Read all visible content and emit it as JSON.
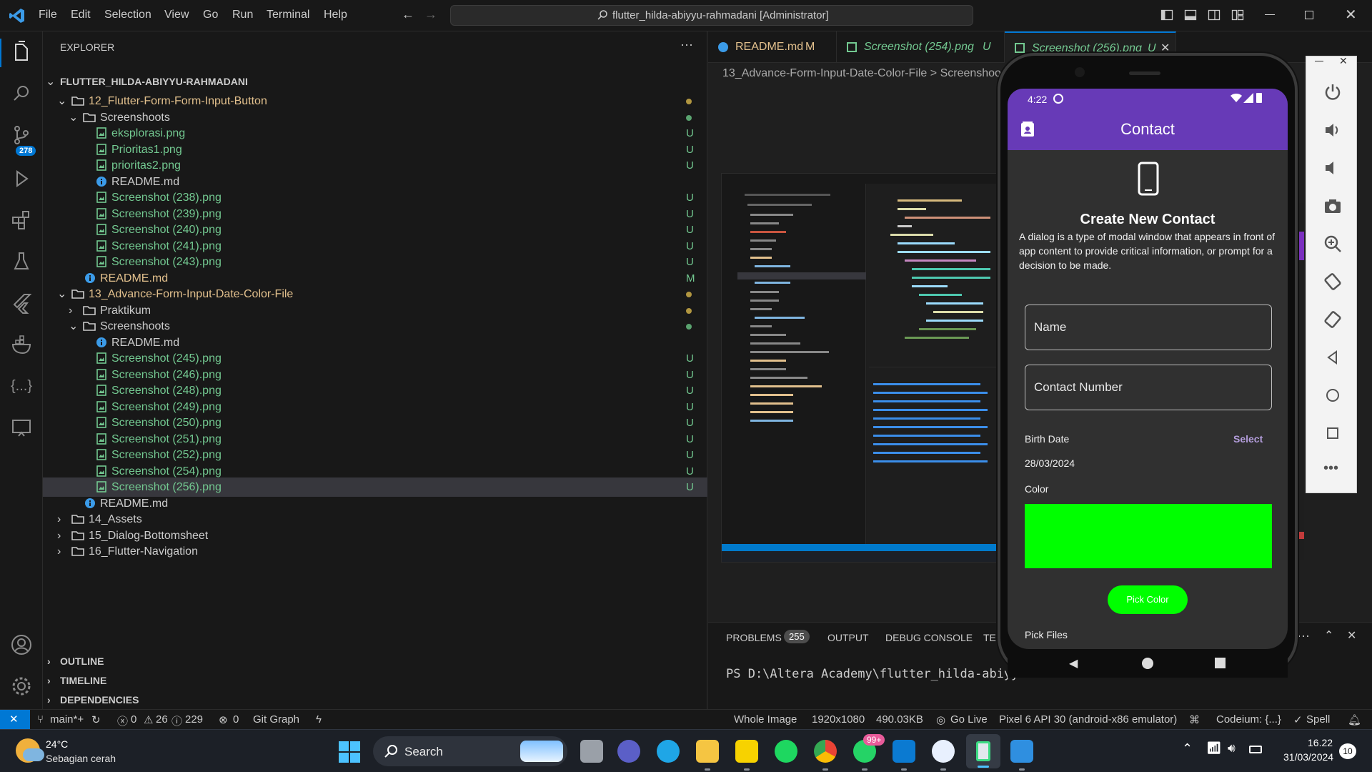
{
  "titlebar": {
    "menus": [
      "File",
      "Edit",
      "Selection",
      "View",
      "Go",
      "Run",
      "Terminal",
      "Help"
    ],
    "command_center": "flutter_hilda-abiyyu-rahmadani [Administrator]"
  },
  "activitybar": {
    "scm_badge": "278"
  },
  "explorer": {
    "title": "EXPLORER",
    "root": "FLUTTER_HILDA-ABIYYU-RAHMADANI",
    "rows": [
      {
        "label": "12_Flutter-Form-Form-Input-Button",
        "status": ""
      },
      {
        "label": "Screenshoots",
        "status": ""
      },
      {
        "label": "eksplorasi.png",
        "status": "U"
      },
      {
        "label": "Prioritas1.png",
        "status": "U"
      },
      {
        "label": "prioritas2.png",
        "status": "U"
      },
      {
        "label": "README.md",
        "status": ""
      },
      {
        "label": "Screenshot (238).png",
        "status": "U"
      },
      {
        "label": "Screenshot (239).png",
        "status": "U"
      },
      {
        "label": "Screenshot (240).png",
        "status": "U"
      },
      {
        "label": "Screenshot (241).png",
        "status": "U"
      },
      {
        "label": "Screenshot (243).png",
        "status": "U"
      },
      {
        "label": "README.md",
        "status": "M"
      },
      {
        "label": "13_Advance-Form-Input-Date-Color-File",
        "status": ""
      },
      {
        "label": "Praktikum",
        "status": ""
      },
      {
        "label": "Screenshoots",
        "status": ""
      },
      {
        "label": "README.md",
        "status": ""
      },
      {
        "label": "Screenshot (245).png",
        "status": "U"
      },
      {
        "label": "Screenshot (246).png",
        "status": "U"
      },
      {
        "label": "Screenshot (248).png",
        "status": "U"
      },
      {
        "label": "Screenshot (249).png",
        "status": "U"
      },
      {
        "label": "Screenshot (250).png",
        "status": "U"
      },
      {
        "label": "Screenshot (251).png",
        "status": "U"
      },
      {
        "label": "Screenshot (252).png",
        "status": "U"
      },
      {
        "label": "Screenshot (254).png",
        "status": "U"
      },
      {
        "label": "Screenshot (256).png",
        "status": "U"
      },
      {
        "label": "README.md",
        "status": ""
      },
      {
        "label": "14_Assets",
        "status": ""
      },
      {
        "label": "15_Dialog-Bottomsheet",
        "status": ""
      },
      {
        "label": "16_Flutter-Navigation",
        "status": ""
      }
    ],
    "sections": [
      "OUTLINE",
      "TIMELINE",
      "DEPENDENCIES"
    ]
  },
  "editor": {
    "tabs": [
      {
        "label": "README.md",
        "status": "M"
      },
      {
        "label": "Screenshot (254).png",
        "status": "U"
      },
      {
        "label": "Screenshot (256).png",
        "status": "U"
      }
    ],
    "breadcrumb": "13_Advance-Form-Input-Date-Color-File  >  Screenshoo"
  },
  "panel": {
    "tabs": [
      "PROBLEMS",
      "OUTPUT",
      "DEBUG CONSOLE",
      "TE"
    ],
    "problems_count": "255",
    "terminal_line": "PS D:\\Altera Academy\\flutter_hilda-abiyyu-r"
  },
  "statusbar": {
    "branch": "main*+",
    "errors": "0",
    "warnings": "26",
    "infos": "229",
    "ports": "0",
    "git_graph": "Git Graph",
    "whole_image": "Whole Image",
    "dimensions": "1920x1080",
    "filesize": "490.03KB",
    "go_live": "Go Live",
    "device": "Pixel 6 API 30 (android-x86 emulator)",
    "codeium": "Codeium: {...}",
    "spell": "Spell"
  },
  "phone": {
    "time": "4:22",
    "appbar_title": "Contact",
    "heading": "Create New Contact",
    "description": "A dialog is a type of modal window that appears in front of app content to provide critical information, or prompt for a decision to be made.",
    "name_placeholder": "Name",
    "contact_placeholder": "Contact Number",
    "birth_label": "Birth Date",
    "select_label": "Select",
    "birth_value": "28/03/2024",
    "color_label": "Color",
    "selected_color": "#00ff00",
    "pick_color_label": "Pick Color",
    "pick_files_label": "Pick Files"
  },
  "taskbar": {
    "weather_temp": "24°C",
    "weather_desc": "Sebagian cerah",
    "search": "Search",
    "whatsapp_badge": "99+",
    "time": "16.22",
    "date": "31/03/2024",
    "notification_count": "10"
  },
  "colors": {
    "accent": "#0078d4",
    "app_purple": "#673ab7",
    "untracked": "#73c991",
    "modified": "#e2c08d"
  }
}
